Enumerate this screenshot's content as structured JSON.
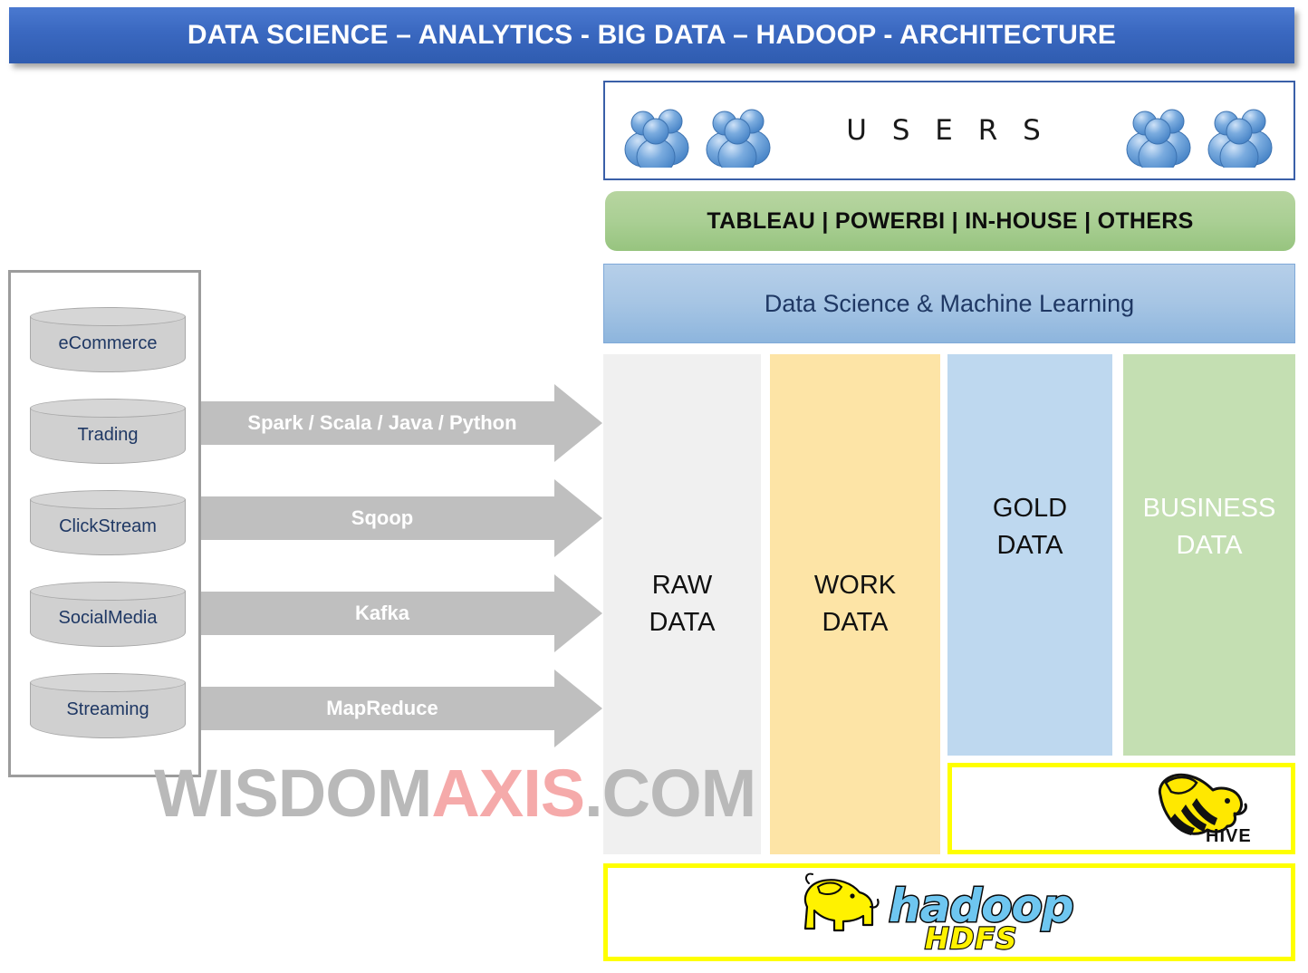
{
  "title": {
    "text": "DATA SCIENCE – ANALYTICS - BIG DATA – HADOOP - ARCHITECTURE",
    "bg_color_top": "#4a79d0",
    "bg_color_bottom": "#2f5cb0",
    "text_color": "#ffffff"
  },
  "users": {
    "label": "U S E R S",
    "icon_name": "user-group-icon",
    "icon_count_left": 2,
    "icon_count_right": 2,
    "border_color": "#3a5fa8"
  },
  "bi_tools": {
    "label": "TABLEAU | POWERBI | IN-HOUSE | OTHERS",
    "tools": [
      "TABLEAU",
      "POWERBI",
      "IN-HOUSE",
      "OTHERS"
    ],
    "bg_color": "#aacf94"
  },
  "data_science": {
    "label": "Data Science & Machine Learning",
    "bg_color": "#a6c5e4",
    "text_color": "#1f3864"
  },
  "sources": {
    "items": [
      {
        "label": "eCommerce"
      },
      {
        "label": "Trading"
      },
      {
        "label": "ClickStream"
      },
      {
        "label": "SocialMedia"
      },
      {
        "label": "Streaming"
      }
    ],
    "cylinder_color": "#d0d0d0",
    "text_color": "#1f3864"
  },
  "ingest_arrows": [
    {
      "label": "Spark / Scala / Java / Python"
    },
    {
      "label": "Sqoop"
    },
    {
      "label": "Kafka"
    },
    {
      "label": "MapReduce"
    }
  ],
  "arrow_color": "#bfbfbf",
  "zones": [
    {
      "line1": "RAW",
      "line2": "DATA",
      "color": "#f0f0f0",
      "text_color": "#101010"
    },
    {
      "line1": "WORK",
      "line2": "DATA",
      "color": "#fde4a6",
      "text_color": "#101010"
    },
    {
      "line1": "GOLD",
      "line2": "DATA",
      "color": "#bed8ef",
      "text_color": "#101010"
    },
    {
      "line1": "BUSINESS",
      "line2": "DATA",
      "color": "#c4dfb2",
      "text_color": "#ffffff"
    }
  ],
  "hive": {
    "name": "HIVE",
    "logo_name": "hive-logo",
    "border_color": "#ffff00"
  },
  "hadoop": {
    "name": "hadoop",
    "subname": "HDFS",
    "logo_name": "hadoop-hdfs-logo",
    "border_color": "#ffff00",
    "word_color": "#6ec6f0",
    "sub_color": "#ffff00"
  },
  "watermark": {
    "part1": "WISDOM",
    "part2": "AXIS",
    "part3": ".COM",
    "color1": "#b9b9b9",
    "color2": "#f5aaaa"
  }
}
